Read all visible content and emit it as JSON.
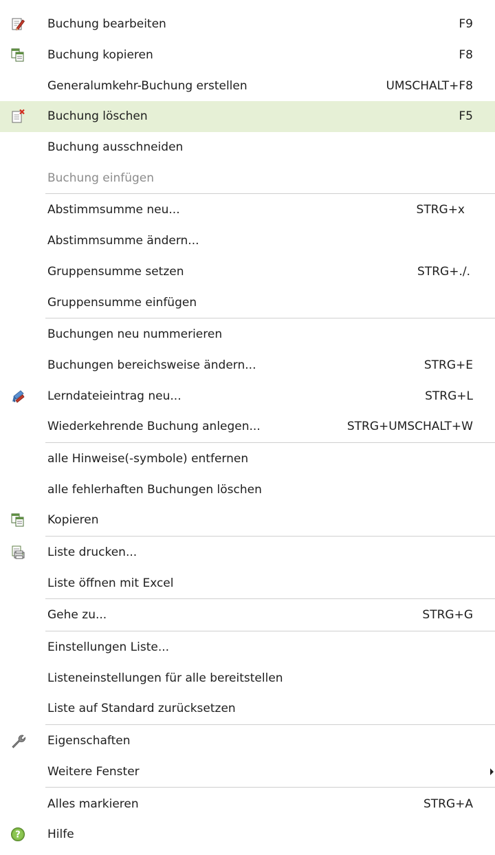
{
  "menu": {
    "items": [
      {
        "label": "Buchung bearbeiten",
        "shortcut": "F9",
        "icon": "edit-booking-icon"
      },
      {
        "label": "Buchung kopieren",
        "shortcut": "F8",
        "icon": "copy-booking-icon"
      },
      {
        "label": "Generalumkehr-Buchung erstellen",
        "shortcut": "UMSCHALT+F8"
      },
      {
        "label": "Buchung löschen",
        "shortcut": "F5",
        "icon": "delete-booking-icon",
        "highlighted": true
      },
      {
        "label": "Buchung ausschneiden",
        "shortcut": ""
      },
      {
        "label": "Buchung einfügen",
        "shortcut": "",
        "disabled": true
      },
      {
        "label": "Abstimmsumme neu...",
        "shortcut": "STRG+x"
      },
      {
        "label": "Abstimmsumme ändern...",
        "shortcut": ""
      },
      {
        "label": "Gruppensumme setzen",
        "shortcut": "STRG+./."
      },
      {
        "label": "Gruppensumme einfügen",
        "shortcut": ""
      },
      {
        "label": "Buchungen neu nummerieren",
        "shortcut": ""
      },
      {
        "label": "Buchungen bereichsweise ändern...",
        "shortcut": "STRG+E"
      },
      {
        "label": "Lerndateieintrag neu...",
        "shortcut": "STRG+L",
        "icon": "learn-file-entry-icon"
      },
      {
        "label": "Wiederkehrende Buchung anlegen...",
        "shortcut": "STRG+UMSCHALT+W"
      },
      {
        "label": "alle Hinweise(-symbole) entfernen",
        "shortcut": ""
      },
      {
        "label": "alle fehlerhaften Buchungen löschen",
        "shortcut": ""
      },
      {
        "label": "Kopieren",
        "shortcut": "",
        "icon": "copy-icon"
      },
      {
        "label": "Liste drucken...",
        "shortcut": "",
        "icon": "print-list-icon"
      },
      {
        "label": "Liste öffnen mit Excel",
        "shortcut": ""
      },
      {
        "label": "Gehe zu...",
        "shortcut": "STRG+G"
      },
      {
        "label": "Einstellungen Liste...",
        "shortcut": ""
      },
      {
        "label": "Listeneinstellungen für alle bereitstellen",
        "shortcut": ""
      },
      {
        "label": "Liste auf Standard zurücksetzen",
        "shortcut": ""
      },
      {
        "label": "Eigenschaften",
        "shortcut": "",
        "icon": "wrench-icon"
      },
      {
        "label": "Weitere Fenster",
        "shortcut": "",
        "submenu": true
      },
      {
        "label": "Alles markieren",
        "shortcut": "STRG+A"
      },
      {
        "label": "Hilfe",
        "shortcut": "",
        "icon": "help-icon"
      }
    ]
  },
  "colors": {
    "highlight": "#e6f0d6",
    "separator": "#cfcfcf",
    "disabled_text": "#8c8c8c",
    "text": "#1e1e1e"
  }
}
